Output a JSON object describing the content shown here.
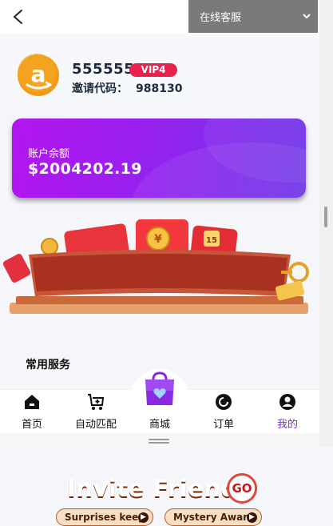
{
  "header": {
    "service_label": "在线客服"
  },
  "profile": {
    "username": "555555",
    "vip_badge": "VIP4",
    "invite_label": "邀请代码：",
    "invite_code": "988130"
  },
  "balance": {
    "label": "账户余额",
    "amount": "$2004202.19"
  },
  "banner": {
    "title": "Invite Friends",
    "go": "GO",
    "pill_left": "Surprises keep",
    "pill_right": "Mystery Award"
  },
  "section": {
    "title": "常用服务"
  },
  "tabs": [
    {
      "label": "首页"
    },
    {
      "label": "自动匹配"
    },
    {
      "label": "商城"
    },
    {
      "label": "订单"
    },
    {
      "label": "我的"
    }
  ],
  "colors": {
    "accent": "#7a2fd6",
    "vip": "#e8224d",
    "card_start": "#b316ee",
    "card_end": "#6f36e8"
  }
}
